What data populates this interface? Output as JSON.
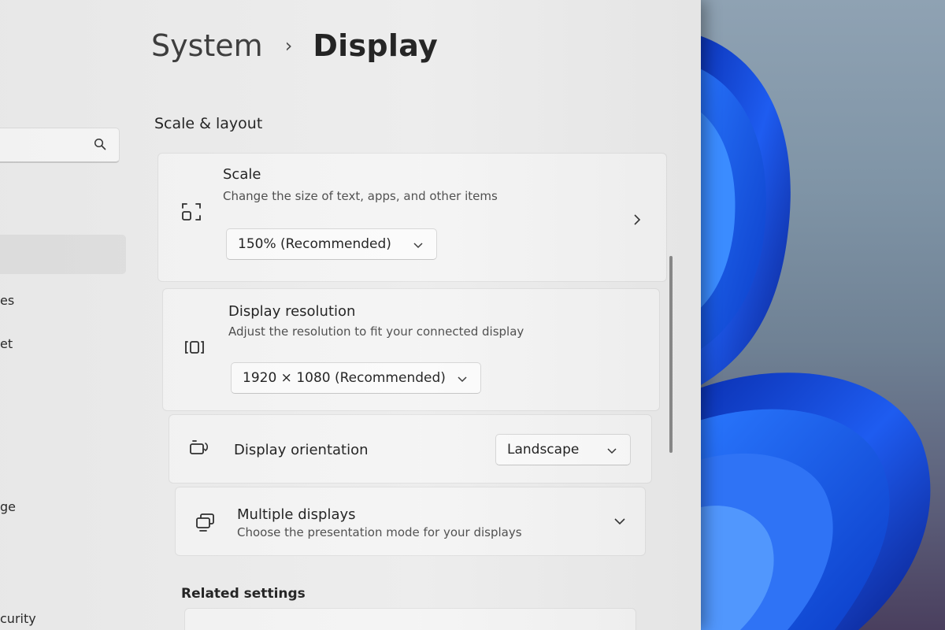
{
  "breadcrumb": {
    "parent": "System",
    "separator": "›",
    "current": "Display"
  },
  "sidebar": {
    "search_icon": "search-icon",
    "fragments": [
      "es",
      "et",
      "ge",
      "curity"
    ]
  },
  "scale_layout": {
    "title": "Scale & layout",
    "scale": {
      "icon": "scale-icon",
      "title": "Scale",
      "description": "Change the size of text, apps, and other items",
      "value": "150% (Recommended)"
    },
    "resolution": {
      "icon": "resolution-icon",
      "title": "Display resolution",
      "description": "Adjust the resolution to fit your connected display",
      "value": "1920 × 1080 (Recommended)"
    },
    "orientation": {
      "icon": "orientation-icon",
      "title": "Display orientation",
      "value": "Landscape"
    },
    "multiple": {
      "icon": "multiple-displays-icon",
      "title": "Multiple displays",
      "description": "Choose the presentation mode for your displays"
    }
  },
  "related": {
    "title": "Related settings"
  },
  "colors": {
    "window_bg": "#ececec",
    "card_bg": "#f4f4f4",
    "wallpaper_accent": "#1a4fd8"
  }
}
